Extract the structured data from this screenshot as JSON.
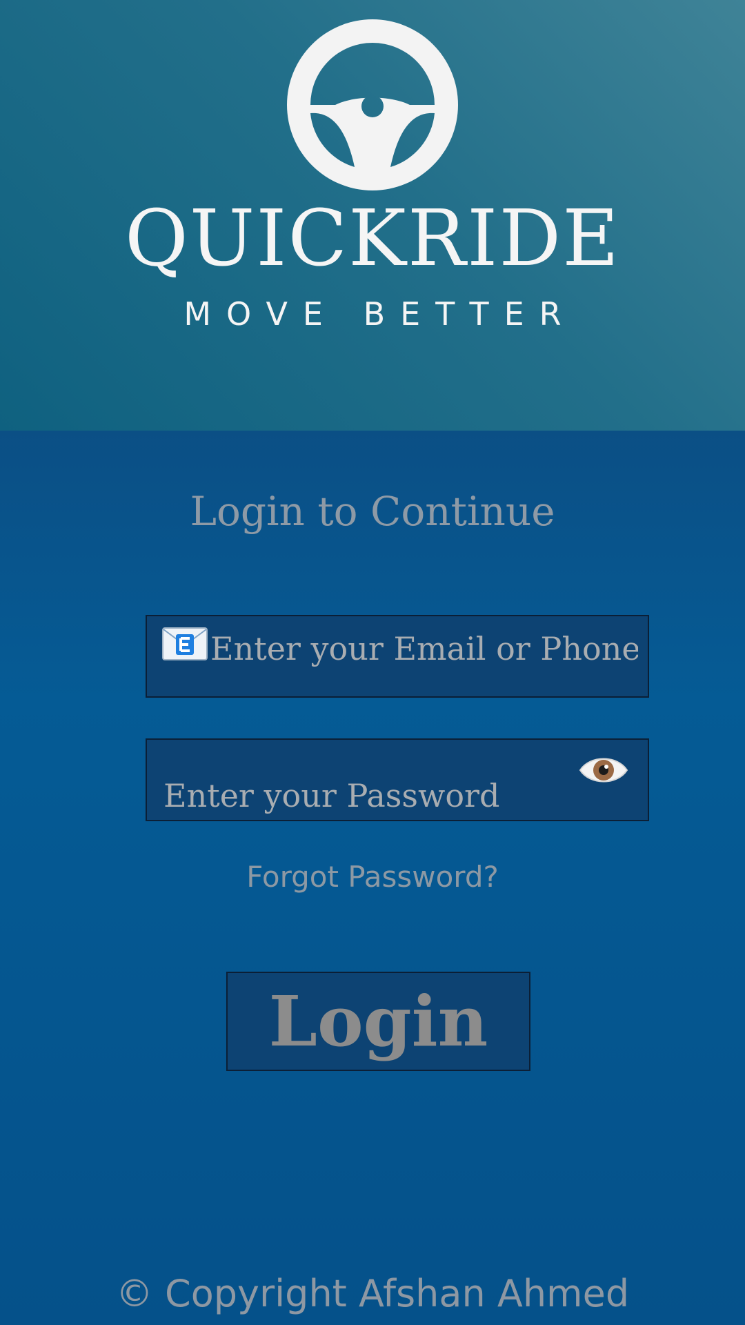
{
  "header": {
    "brand_name": "QUICKRIDE",
    "tagline": "MOVE BETTER",
    "logo_icon": "steering-wheel-icon"
  },
  "login": {
    "heading": "Login to Continue",
    "email_placeholder": "Enter your Email or Phone",
    "email_icon": "email-icon",
    "password_placeholder": "Enter your Password",
    "password_toggle_icon": "eye-icon",
    "forgot_password": "Forgot Password?",
    "login_button": "Login"
  },
  "footer": {
    "copyright": "© Copyright Afshan Ahmed"
  },
  "colors": {
    "header_bg": "#226f8a",
    "main_bg": "#055b95",
    "field_bg": "#0d4373",
    "text_muted": "#8e9aa6"
  }
}
